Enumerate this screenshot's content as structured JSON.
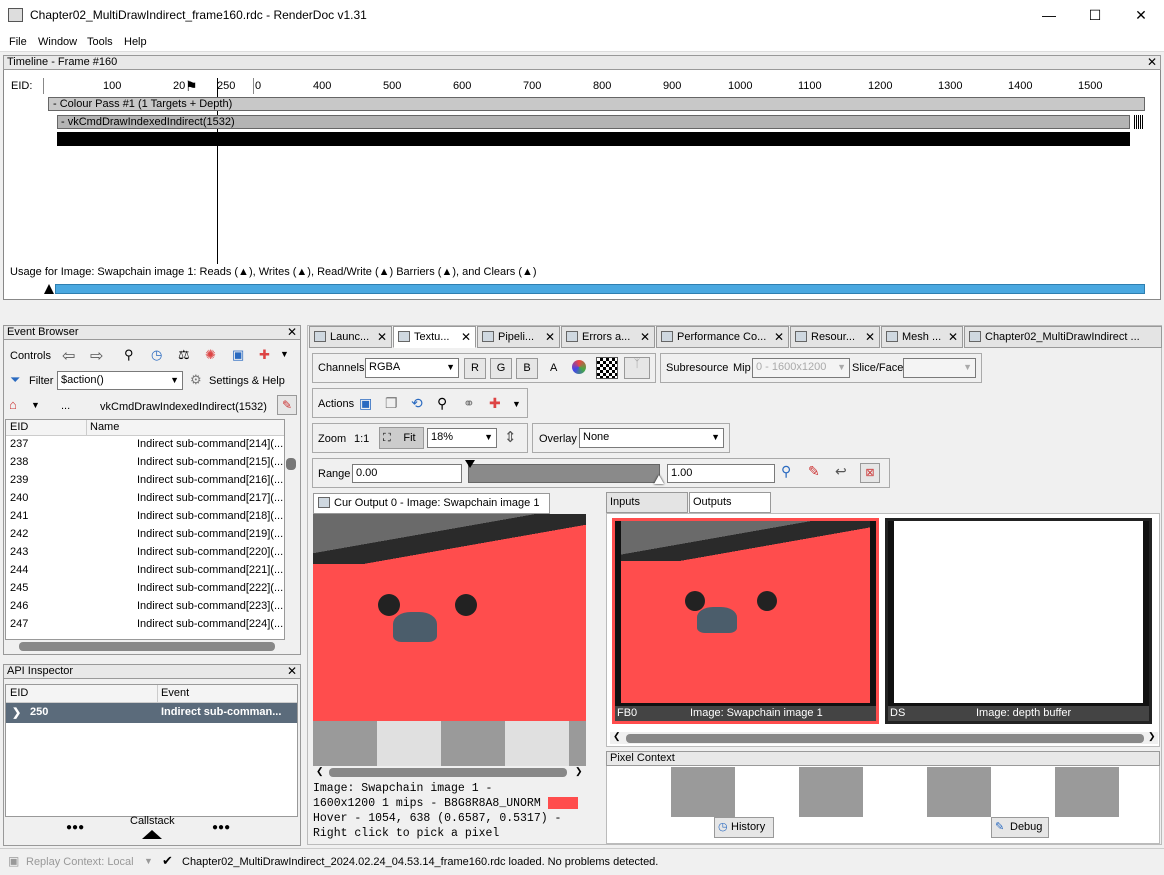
{
  "window": {
    "title": "Chapter02_MultiDrawIndirect_frame160.rdc - RenderDoc v1.31",
    "minimize": "—",
    "maximize": "☐",
    "close": "✕"
  },
  "menu": [
    "File",
    "Window",
    "Tools",
    "Help"
  ],
  "timeline": {
    "title": "Timeline - Frame #160",
    "eid_label": "EID:",
    "ticks": [
      "100",
      "20",
      "250",
      "0",
      "400",
      "500",
      "600",
      "700",
      "800",
      "900",
      "1000",
      "1100",
      "1200",
      "1300",
      "1400",
      "1500"
    ],
    "colour_pass": "-  Colour Pass #1 (1 Targets + Depth)",
    "draw_call": "-  vkCmdDrawIndexedIndirect(1532)",
    "usage": "Usage for Image: Swapchain image 1: Reads (▲), Writes (▲), Read/Write (▲) Barriers (▲), and Clears (▲)"
  },
  "event_browser": {
    "title": "Event Browser",
    "controls": "Controls",
    "filter_label": "Filter",
    "filter_value": "$action()",
    "settings": "Settings & Help",
    "breadcrumb_dots": "...",
    "current": "vkCmdDrawIndexedIndirect(1532)",
    "columns": [
      "EID",
      "Name"
    ],
    "rows": [
      [
        "237",
        "Indirect sub-command[214](..."
      ],
      [
        "238",
        "Indirect sub-command[215](..."
      ],
      [
        "239",
        "Indirect sub-command[216](..."
      ],
      [
        "240",
        "Indirect sub-command[217](..."
      ],
      [
        "241",
        "Indirect sub-command[218](..."
      ],
      [
        "242",
        "Indirect sub-command[219](..."
      ],
      [
        "243",
        "Indirect sub-command[220](..."
      ],
      [
        "244",
        "Indirect sub-command[221](..."
      ],
      [
        "245",
        "Indirect sub-command[222](..."
      ],
      [
        "246",
        "Indirect sub-command[223](..."
      ],
      [
        "247",
        "Indirect sub-command[224](..."
      ]
    ]
  },
  "api_inspector": {
    "title": "API Inspector",
    "columns": [
      "EID",
      "Event"
    ],
    "row": [
      "250",
      "Indirect sub-comman..."
    ],
    "callstack": "Callstack",
    "dots": "●●●"
  },
  "tabs": [
    "Launc...",
    "Textu...",
    "Pipeli...",
    "Errors a...",
    "Performance Co...",
    "Resour...",
    "Mesh ...",
    "Chapter02_MultiDrawIndirect ..."
  ],
  "texture_viewer": {
    "channels_label": "Channels",
    "channels_value": "RGBA",
    "r": "R",
    "g": "G",
    "b": "B",
    "a": "A",
    "subresource": "Subresource",
    "mip_label": "Mip",
    "mip_value": "0 - 1600x1200",
    "slice_label": "Slice/Face",
    "actions_label": "Actions",
    "zoom_label": "Zoom",
    "zoom_1to1": "1:1",
    "fit": "Fit",
    "zoom_value": "18%",
    "overlay_label": "Overlay",
    "overlay_value": "None",
    "range_label": "Range",
    "range_min": "0.00",
    "range_max": "1.00",
    "cur_output_tab": "Cur Output 0 - Image: Swapchain image 1",
    "info_line1": "Image: Swapchain image 1 -",
    "info_line2": "1600x1200 1 mips - B8G8R8A8_UNORM",
    "info_line3": "Hover -  1054,  638 (0.6587, 0.5317)  -",
    "info_line4": "Right click to pick a pixel",
    "inputs_tab": "Inputs",
    "outputs_tab": "Outputs",
    "fb0_label": "FB0",
    "fb0_name": "Image: Swapchain image 1",
    "ds_label": "DS",
    "ds_name": "Image: depth buffer",
    "pixel_context": "Pixel Context",
    "history": "History",
    "debug": "Debug"
  },
  "status": {
    "replay": "Replay Context: Local",
    "message": "Chapter02_MultiDrawIndirect_2024.02.24_04.53.14_frame160.rdc loaded. No problems detected."
  },
  "colors": {
    "scene_red": "#ff4d4d",
    "accent_blue": "#4aa8e0",
    "selection": "#5b6b7b"
  }
}
